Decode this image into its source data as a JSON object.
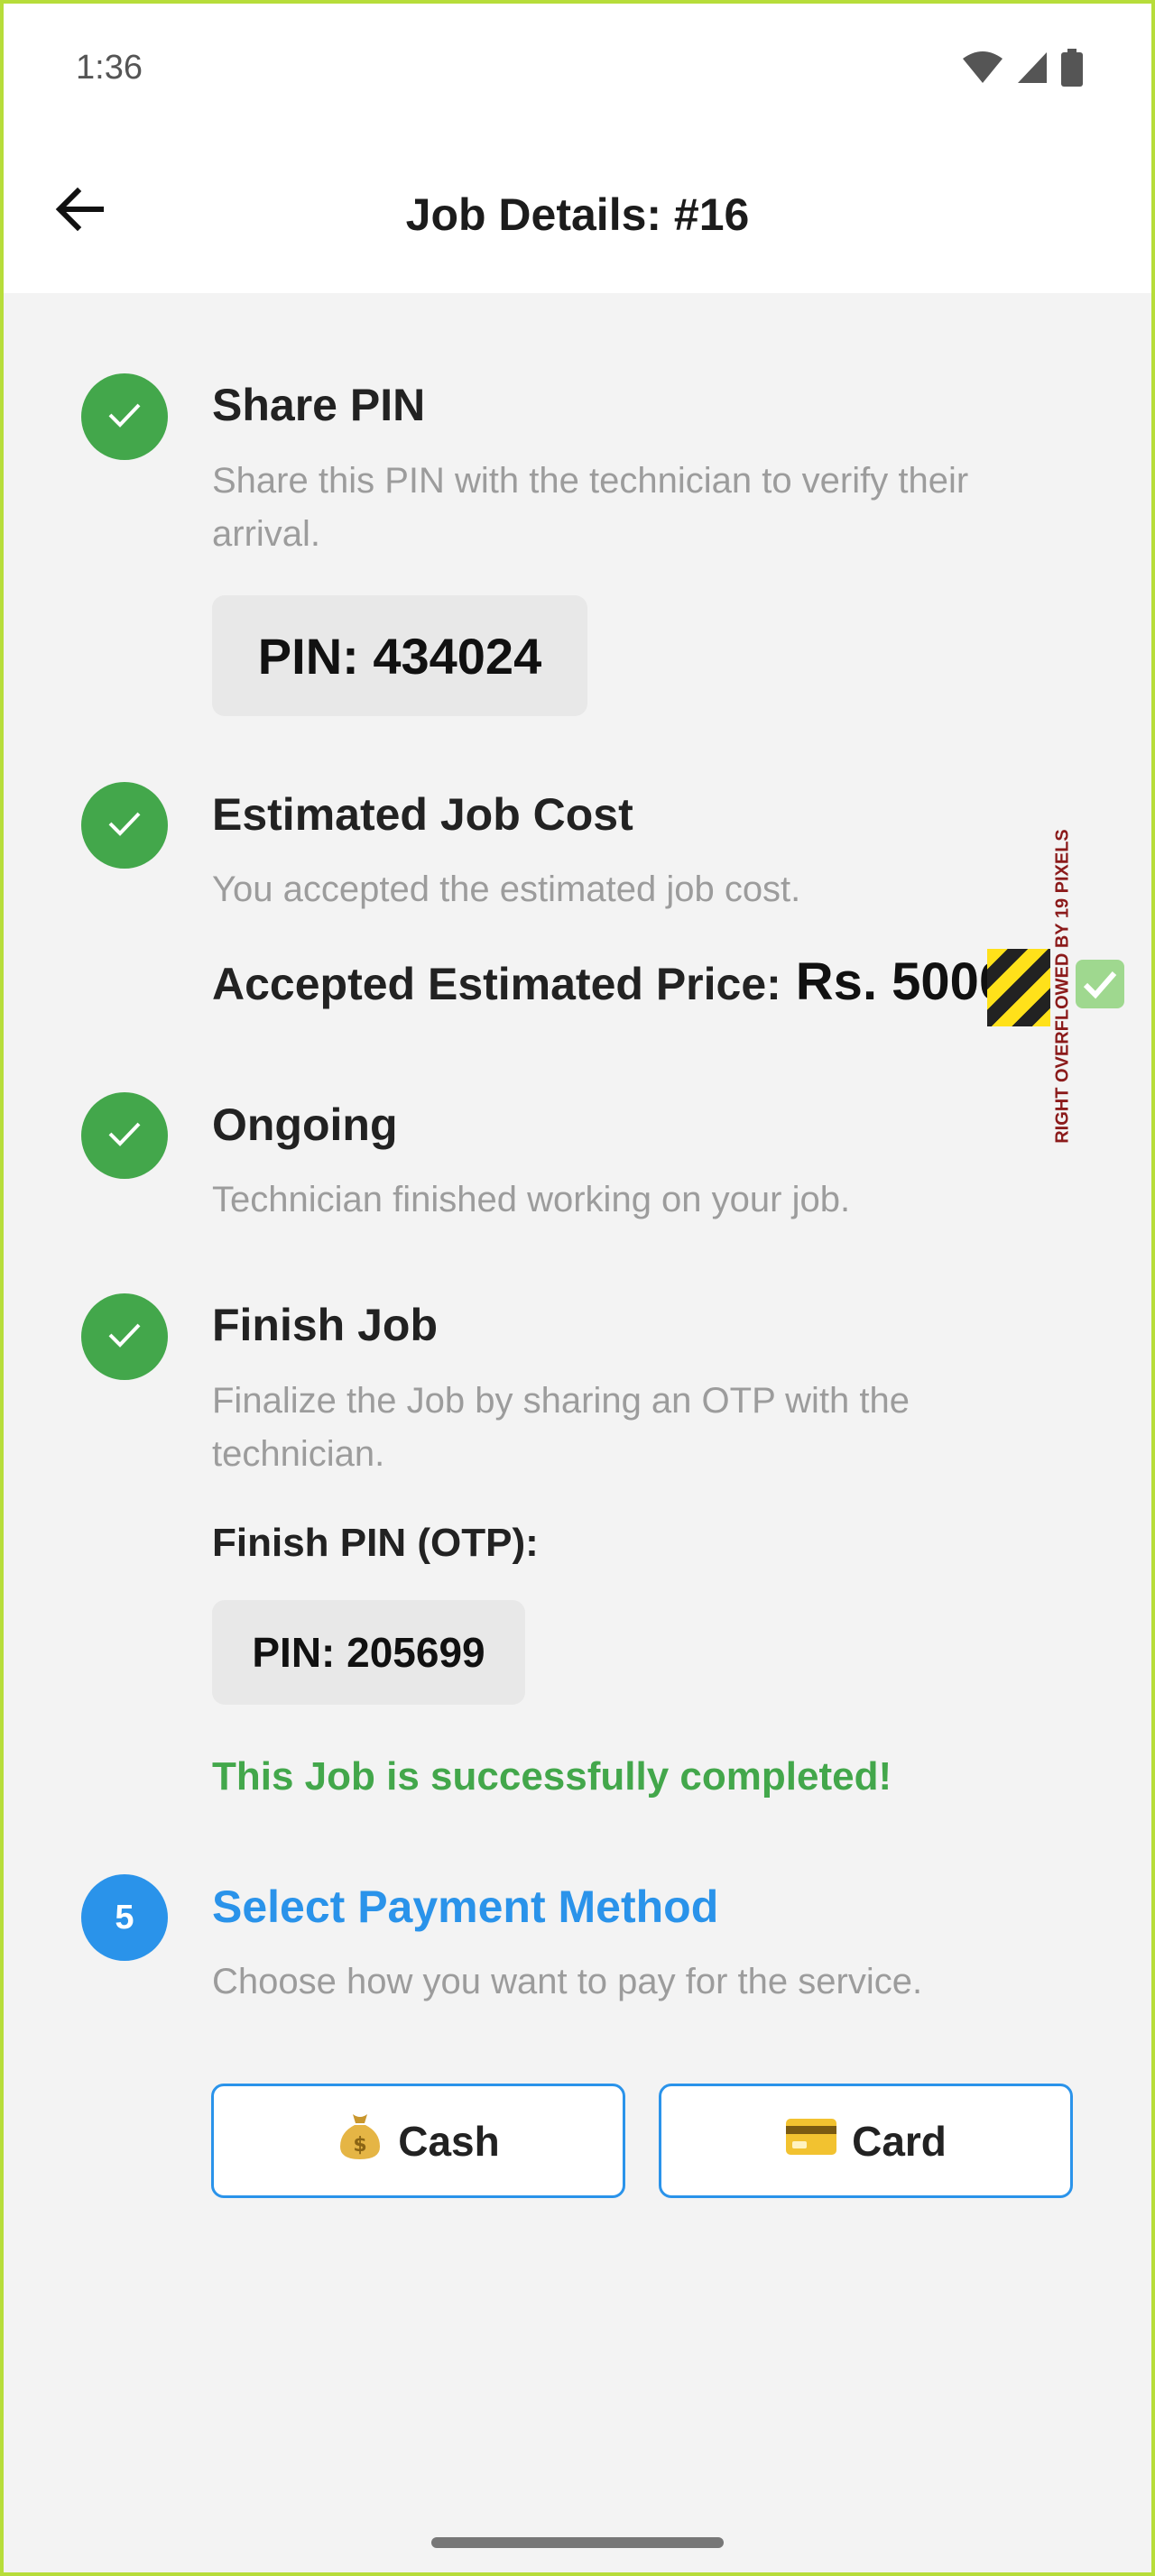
{
  "status_bar": {
    "time": "1:36"
  },
  "app_bar": {
    "title": "Job Details: #16"
  },
  "steps": [
    {
      "title": "Share PIN",
      "description": "Share this PIN with the technician to verify their arrival.",
      "pin": "PIN: 434024",
      "status": "done"
    },
    {
      "title": "Estimated Job Cost",
      "description": "You accepted the estimated job cost.",
      "price_label": "Accepted Estimated Price:",
      "price_value": "Rs. 5000",
      "status": "done"
    },
    {
      "title": "Ongoing",
      "description": "Technician finished working on your job.",
      "status": "done"
    },
    {
      "title": "Finish Job",
      "description": "Finalize the Job by sharing an OTP with the technician.",
      "finish_pin_label": "Finish PIN (OTP):",
      "pin": "PIN: 205699",
      "success_message": "This Job is successfully completed!",
      "status": "done"
    },
    {
      "number": "5",
      "title": "Select Payment Method",
      "description": "Choose how you want to pay for the service.",
      "status": "active"
    }
  ],
  "payment": {
    "cash_label": "Cash",
    "card_label": "Card"
  },
  "debug": {
    "overflow_message": "RIGHT OVERFLOWED BY 19 PIXELS"
  },
  "colors": {
    "done": "#43a74b",
    "active": "#2a93ea",
    "frame": "#b7dd3a"
  }
}
